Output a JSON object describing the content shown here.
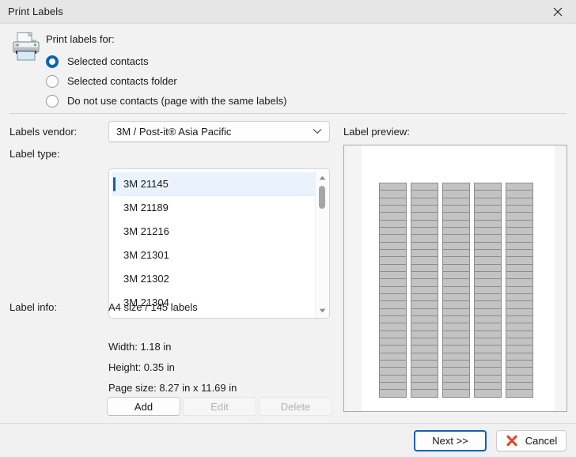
{
  "window": {
    "title": "Print Labels",
    "close_icon": "close-icon"
  },
  "print_for": {
    "heading": "Print labels for:",
    "icon": "printer-icon",
    "options": [
      {
        "label": "Selected contacts",
        "checked": true
      },
      {
        "label": "Selected contacts folder",
        "checked": false
      },
      {
        "label": "Do not use contacts (page with the same labels)",
        "checked": false
      }
    ]
  },
  "vendor": {
    "label": "Labels vendor:",
    "value": "3M / Post-it®  Asia Pacific",
    "chevron_icon": "chevron-down-icon"
  },
  "label_type": {
    "label": "Label type:",
    "items": [
      "3M 21145",
      "3M 21189",
      "3M 21216",
      "3M 21301",
      "3M 21302",
      "3M 21304"
    ],
    "selected_index": 0,
    "scrollbar": {
      "up_icon": "scroll-up-arrow-icon",
      "down_icon": "scroll-down-arrow-icon"
    }
  },
  "label_info": {
    "label": "Label info:",
    "size": "A4 size / 145 labels",
    "width": "Width: 1.18 in",
    "height": "Height: 0.35 in",
    "page_size": "Page size: 8.27 in x 11.69 in"
  },
  "actions": {
    "add": "Add",
    "edit": "Edit",
    "delete": "Delete"
  },
  "preview": {
    "label": "Label preview:",
    "columns": 5,
    "rows": 29
  },
  "footer": {
    "next": "Next  >>",
    "cancel": "Cancel",
    "cancel_icon": "red-x-icon"
  },
  "colors": {
    "accent": "#0b63ba",
    "selection_bg": "#eaf3fc",
    "cancel_icon": "#e8442b",
    "label_fill": "#c3c3c3",
    "window_bg": "#f2f2f2"
  }
}
